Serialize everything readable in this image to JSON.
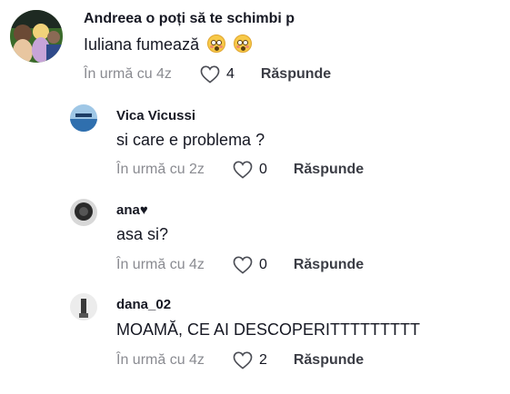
{
  "comment": {
    "username": "Andreea o poți să te schimbi p",
    "text": "Iuliana fumează",
    "emojis": [
      "flushed-face-emoji",
      "flushed-face-emoji"
    ],
    "time": "În urmă cu 4z",
    "likes": "4",
    "reply_label": "Răspunde"
  },
  "replies": [
    {
      "username": "Vica Vicussi",
      "text": "si care e problema ?",
      "time": "În urmă cu 2z",
      "likes": "0",
      "reply_label": "Răspunde"
    },
    {
      "username": "ana♥",
      "text": "asa si?",
      "time": "În urmă cu 4z",
      "likes": "0",
      "reply_label": "Răspunde"
    },
    {
      "username": "dana_02",
      "text": "MOAMĂ, CE AI DESCOPERITTTTTTTTT",
      "time": "În urmă cu 4z",
      "likes": "2",
      "reply_label": "Răspunde"
    }
  ],
  "colors": {
    "text": "#161823",
    "muted": "#8a8b91",
    "reply": "#3b3d45",
    "icon": "#4b4d55"
  }
}
